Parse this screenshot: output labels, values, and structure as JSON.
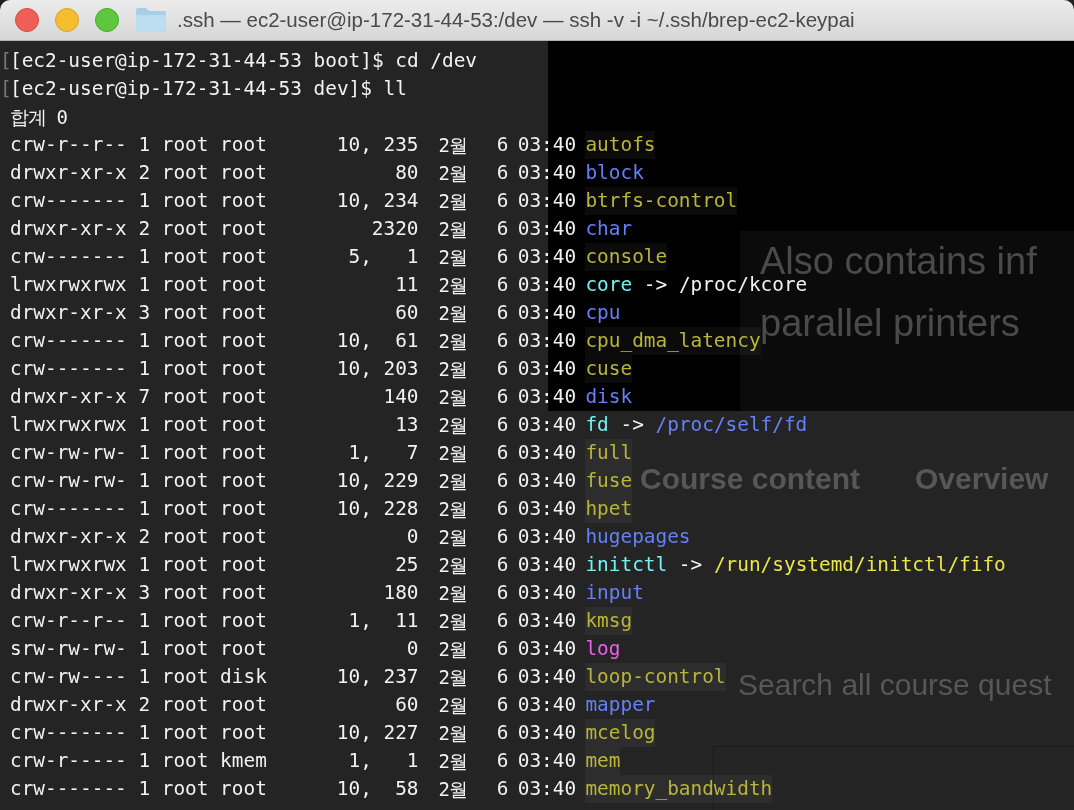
{
  "window": {
    "title": ".ssh — ec2-user@ip-172-31-44-53:/dev — ssh -v -i ~/.ssh/brep-ec2-keypai"
  },
  "backdrop_texts": [
    {
      "text": "Also contains inf",
      "kind": "large"
    },
    {
      "text": "parallel printers",
      "kind": "large"
    },
    {
      "text": "Course content",
      "kind": "tab"
    },
    {
      "text": "Overview",
      "kind": "tab"
    },
    {
      "text": "Search all course quest",
      "kind": "search"
    }
  ],
  "prompts": [
    {
      "mark": "[",
      "prompt": "[ec2-user@ip-172-31-44-53 boot]$",
      "command": "cd /dev"
    },
    {
      "mark": "[",
      "prompt": "[ec2-user@ip-172-31-44-53 dev]$",
      "command": "ll"
    }
  ],
  "total": "합계 0",
  "rows": [
    {
      "perms": "crw-r--r--",
      "links": "1",
      "owner": "root",
      "group": "root",
      "size": "10, 235",
      "month": "2월",
      "day": "6",
      "time": "03:40",
      "name": "autofs",
      "kind": "device"
    },
    {
      "perms": "drwxr-xr-x",
      "links": "2",
      "owner": "root",
      "group": "root",
      "size": "80",
      "month": "2월",
      "day": "6",
      "time": "03:40",
      "name": "block",
      "kind": "dir"
    },
    {
      "perms": "crw-------",
      "links": "1",
      "owner": "root",
      "group": "root",
      "size": "10, 234",
      "month": "2월",
      "day": "6",
      "time": "03:40",
      "name": "btrfs-control",
      "kind": "device"
    },
    {
      "perms": "drwxr-xr-x",
      "links": "2",
      "owner": "root",
      "group": "root",
      "size": "2320",
      "month": "2월",
      "day": "6",
      "time": "03:40",
      "name": "char",
      "kind": "dir"
    },
    {
      "perms": "crw-------",
      "links": "1",
      "owner": "root",
      "group": "root",
      "size": "5,   1",
      "month": "2월",
      "day": "6",
      "time": "03:40",
      "name": "console",
      "kind": "device"
    },
    {
      "perms": "lrwxrwxrwx",
      "links": "1",
      "owner": "root",
      "group": "root",
      "size": "11",
      "month": "2월",
      "day": "6",
      "time": "03:40",
      "name": "core",
      "kind": "link",
      "arrow": "->",
      "target": {
        "text": "/proc/kcore",
        "kind": "plain"
      }
    },
    {
      "perms": "drwxr-xr-x",
      "links": "3",
      "owner": "root",
      "group": "root",
      "size": "60",
      "month": "2월",
      "day": "6",
      "time": "03:40",
      "name": "cpu",
      "kind": "dir"
    },
    {
      "perms": "crw-------",
      "links": "1",
      "owner": "root",
      "group": "root",
      "size": "10,  61",
      "month": "2월",
      "day": "6",
      "time": "03:40",
      "name": "cpu_dma_latency",
      "kind": "device"
    },
    {
      "perms": "crw-------",
      "links": "1",
      "owner": "root",
      "group": "root",
      "size": "10, 203",
      "month": "2월",
      "day": "6",
      "time": "03:40",
      "name": "cuse",
      "kind": "device"
    },
    {
      "perms": "drwxr-xr-x",
      "links": "7",
      "owner": "root",
      "group": "root",
      "size": "140",
      "month": "2월",
      "day": "6",
      "time": "03:40",
      "name": "disk",
      "kind": "dir"
    },
    {
      "perms": "lrwxrwxrwx",
      "links": "1",
      "owner": "root",
      "group": "root",
      "size": "13",
      "month": "2월",
      "day": "6",
      "time": "03:40",
      "name": "fd",
      "kind": "link",
      "arrow": "->",
      "target": {
        "text": "/proc/self/fd",
        "kind": "dir"
      }
    },
    {
      "perms": "crw-rw-rw-",
      "links": "1",
      "owner": "root",
      "group": "root",
      "size": "1,   7",
      "month": "2월",
      "day": "6",
      "time": "03:40",
      "name": "full",
      "kind": "device"
    },
    {
      "perms": "crw-rw-rw-",
      "links": "1",
      "owner": "root",
      "group": "root",
      "size": "10, 229",
      "month": "2월",
      "day": "6",
      "time": "03:40",
      "name": "fuse",
      "kind": "device"
    },
    {
      "perms": "crw-------",
      "links": "1",
      "owner": "root",
      "group": "root",
      "size": "10, 228",
      "month": "2월",
      "day": "6",
      "time": "03:40",
      "name": "hpet",
      "kind": "device"
    },
    {
      "perms": "drwxr-xr-x",
      "links": "2",
      "owner": "root",
      "group": "root",
      "size": "0",
      "month": "2월",
      "day": "6",
      "time": "03:40",
      "name": "hugepages",
      "kind": "dir"
    },
    {
      "perms": "lrwxrwxrwx",
      "links": "1",
      "owner": "root",
      "group": "root",
      "size": "25",
      "month": "2월",
      "day": "6",
      "time": "03:40",
      "name": "initctl",
      "kind": "link",
      "arrow": "->",
      "target": {
        "text": "/run/systemd/initctl/fifo",
        "kind": "pipe"
      }
    },
    {
      "perms": "drwxr-xr-x",
      "links": "3",
      "owner": "root",
      "group": "root",
      "size": "180",
      "month": "2월",
      "day": "6",
      "time": "03:40",
      "name": "input",
      "kind": "dir"
    },
    {
      "perms": "crw-r--r--",
      "links": "1",
      "owner": "root",
      "group": "root",
      "size": "1,  11",
      "month": "2월",
      "day": "6",
      "time": "03:40",
      "name": "kmsg",
      "kind": "device"
    },
    {
      "perms": "srw-rw-rw-",
      "links": "1",
      "owner": "root",
      "group": "root",
      "size": "0",
      "month": "2월",
      "day": "6",
      "time": "03:40",
      "name": "log",
      "kind": "socket"
    },
    {
      "perms": "crw-rw----",
      "links": "1",
      "owner": "root",
      "group": "disk",
      "size": "10, 237",
      "month": "2월",
      "day": "6",
      "time": "03:40",
      "name": "loop-control",
      "kind": "device"
    },
    {
      "perms": "drwxr-xr-x",
      "links": "2",
      "owner": "root",
      "group": "root",
      "size": "60",
      "month": "2월",
      "day": "6",
      "time": "03:40",
      "name": "mapper",
      "kind": "dir"
    },
    {
      "perms": "crw-------",
      "links": "1",
      "owner": "root",
      "group": "root",
      "size": "10, 227",
      "month": "2월",
      "day": "6",
      "time": "03:40",
      "name": "mcelog",
      "kind": "device"
    },
    {
      "perms": "crw-r-----",
      "links": "1",
      "owner": "root",
      "group": "kmem",
      "size": "1,   1",
      "month": "2월",
      "day": "6",
      "time": "03:40",
      "name": "mem",
      "kind": "device"
    },
    {
      "perms": "crw-------",
      "links": "1",
      "owner": "root",
      "group": "root",
      "size": "10,  58",
      "month": "2월",
      "day": "6",
      "time": "03:40",
      "name": "memory_bandwidth",
      "kind": "device"
    }
  ]
}
